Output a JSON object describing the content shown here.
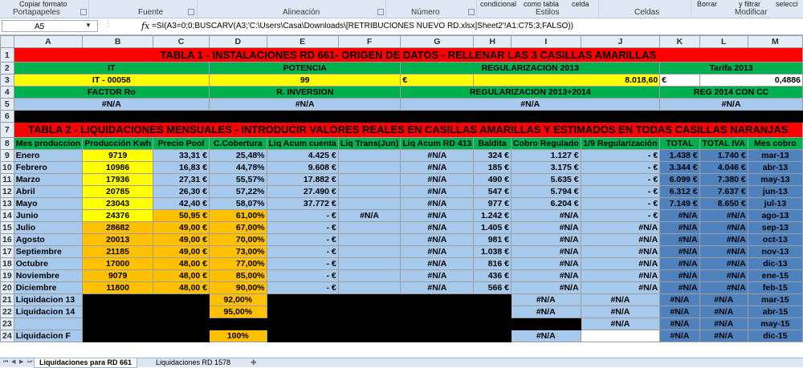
{
  "ribbon": {
    "copy_format": "Copiar formato",
    "groups": [
      "Portapapeles",
      "Fuente",
      "Alineación",
      "Número",
      "Estilos",
      "Celdas",
      "Modificar"
    ],
    "styles_buttons": [
      "condicional",
      "como tabla",
      "celda"
    ],
    "modify_buttons": [
      "Borrar",
      "y filtrar",
      "selecci"
    ]
  },
  "formula_bar": {
    "name_box": "A5",
    "fx": "fx",
    "formula": "=SI(A3=0;0;BUSCARV(A3;'C:\\Users\\Casa\\Downloads\\[RETRIBUCIONES NUEVO RD.xlsx]Sheet2'!A1:C75;3;FALSO))"
  },
  "columns": [
    "A",
    "B",
    "C",
    "D",
    "E",
    "F",
    "G",
    "H",
    "I",
    "J",
    "K",
    "L",
    "M"
  ],
  "rows": [
    "1",
    "2",
    "3",
    "4",
    "5",
    "6",
    "7",
    "8",
    "9",
    "10",
    "11",
    "12",
    "13",
    "14",
    "15",
    "16",
    "17",
    "18",
    "19",
    "20",
    "21",
    "22",
    "23",
    "24"
  ],
  "sheet": {
    "r1": "TABLA 1 - INSTALACIONES RD 661- ORIGEN DE DATOS - RELLENAR LAS 3 CASILLAS AMARILLAS",
    "r2": [
      "IT",
      "POTENCIA",
      "REGULARIZACION 2013",
      "Tarifa 2013"
    ],
    "r3": [
      "IT - 00058",
      "99",
      "€",
      "8.018,60",
      "€",
      "0,4886"
    ],
    "r4": [
      "FACTOR Ro",
      "R. INVERSION",
      "REGULARIZACION  2013+2014",
      "REG 2014 CON CC"
    ],
    "r5": [
      "#N/A",
      "#N/A",
      "#N/A",
      "#N/A"
    ],
    "r7": "TABLA 2 - LIQUIDACIONES MENSUALES - INTRODUCIR VALORES REALES EN CASILLAS AMARILLAS Y ESTIMADOS EN TODAS CASILLAS NARANJAS",
    "headers": [
      "Mes produccion",
      "Producción Kwh",
      "Precio Pool",
      "C.Cobertura",
      "Liq Acum cuenta",
      "Liq Trans(Jun)",
      "Liq Acum RD 413",
      "Baldita",
      "Cobro Regulado",
      "1/9 Regularización",
      "TOTAL",
      "TOTAL IVA",
      "Mes cobro"
    ],
    "months": [
      [
        "Enero",
        "9719",
        "33,31 €",
        "25,48%",
        "4.425 €",
        "",
        "#N/A",
        "324 €",
        "1.127 €",
        "- €",
        "1.438 €",
        "1.740 €",
        "mar-13"
      ],
      [
        "Febrero",
        "10986",
        "16,83 €",
        "44,78%",
        "9.608 €",
        "",
        "#N/A",
        "185 €",
        "3.175 €",
        "- €",
        "3.344 €",
        "4.046 €",
        "abr-13"
      ],
      [
        "Marzo",
        "17936",
        "27,31 €",
        "55,57%",
        "17.882 €",
        "",
        "#N/A",
        "490 €",
        "5.635 €",
        "- €",
        "6.099 €",
        "7.380 €",
        "may-13"
      ],
      [
        "Abril",
        "20785",
        "26,30 €",
        "57,22%",
        "27.490 €",
        "",
        "#N/A",
        "547 €",
        "5.794 €",
        "- €",
        "6.312 €",
        "7.637 €",
        "jun-13"
      ],
      [
        "Mayo",
        "23043",
        "42,40 €",
        "58,07%",
        "37.772 €",
        "",
        "#N/A",
        "977 €",
        "6.204 €",
        "- €",
        "7.149 €",
        "8.650 €",
        "jul-13"
      ],
      [
        "Junio",
        "24376",
        "50,95 €",
        "61,00%",
        "-   €",
        "#N/A",
        "#N/A",
        "1.242 €",
        "#N/A",
        "- €",
        "#N/A",
        "#N/A",
        "ago-13"
      ],
      [
        "Julio",
        "28682",
        "49,00 €",
        "67,00%",
        "-   €",
        "",
        "#N/A",
        "1.405 €",
        "#N/A",
        "#N/A",
        "#N/A",
        "#N/A",
        "sep-13"
      ],
      [
        "Agosto",
        "20013",
        "49,00 €",
        "70,00%",
        "-   €",
        "",
        "#N/A",
        "981 €",
        "#N/A",
        "#N/A",
        "#N/A",
        "#N/A",
        "oct-13"
      ],
      [
        "Septiembre",
        "21185",
        "49,00 €",
        "73,00%",
        "-   €",
        "",
        "#N/A",
        "1.038 €",
        "#N/A",
        "#N/A",
        "#N/A",
        "#N/A",
        "nov-13"
      ],
      [
        "Octubre",
        "17000",
        "48,00 €",
        "77,00%",
        "-   €",
        "",
        "#N/A",
        "816 €",
        "#N/A",
        "#N/A",
        "#N/A",
        "#N/A",
        "dic-13"
      ],
      [
        "Noviembre",
        "9079",
        "48,00 €",
        "85,00%",
        "-   €",
        "",
        "#N/A",
        "436 €",
        "#N/A",
        "#N/A",
        "#N/A",
        "#N/A",
        "ene-15"
      ],
      [
        "Diciembre",
        "11800",
        "48,00 €",
        "90,00%",
        "-   €",
        "",
        "#N/A",
        "566 €",
        "#N/A",
        "#N/A",
        "#N/A",
        "#N/A",
        "feb-15"
      ]
    ],
    "liq": [
      [
        "Liquidacion 13",
        "92,00%",
        "#N/A",
        "#N/A",
        "#N/A",
        "mar-15"
      ],
      [
        "Liquidacion 14",
        "95,00%",
        "#N/A",
        "#N/A",
        "#N/A",
        "abr-15"
      ],
      [
        "",
        "",
        "",
        "#N/A",
        "#N/A",
        "may-15"
      ],
      [
        "Liquidacion F",
        "100%",
        "#N/A",
        "#N/A",
        "#N/A",
        "dic-15"
      ]
    ]
  },
  "tabs": [
    "Liquidaciones para RD 661",
    "Liquidaciones RD 1578"
  ]
}
